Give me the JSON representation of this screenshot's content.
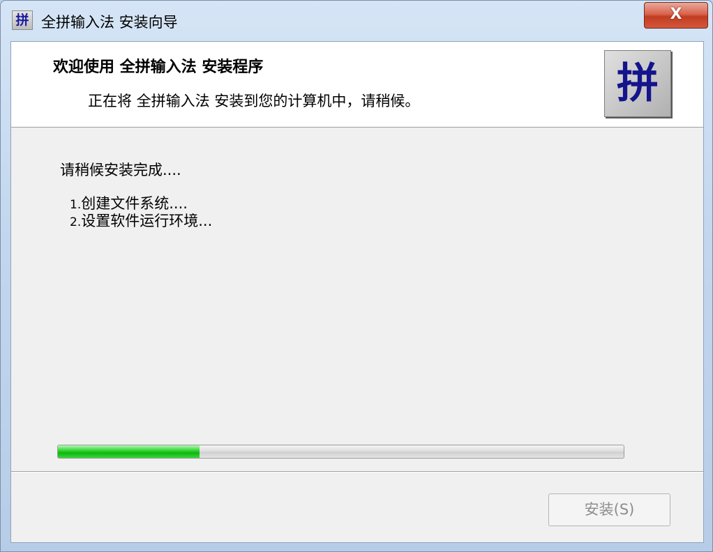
{
  "window": {
    "title": "全拼输入法 安装向导",
    "app_icon_glyph": "拼",
    "close_glyph": "X"
  },
  "header": {
    "title": "欢迎使用  全拼输入法  安装程序",
    "subtitle": "正在将 全拼输入法 安装到您的计算机中，请稍候。",
    "logo_glyph": "拼"
  },
  "content": {
    "status": "请稍候安装完成....",
    "steps": [
      {
        "num": "1.",
        "label": "创建文件系统...."
      },
      {
        "num": "2.",
        "label": "设置软件运行环境..."
      }
    ]
  },
  "progress": {
    "fraction": 0.25
  },
  "buttons": {
    "install_label": "安装(S)"
  },
  "colors": {
    "progress_fill": "#0db80d",
    "close_button": "#c23d22",
    "logo_text": "#14148c"
  },
  "icons": {
    "app": "pinyin-app-icon",
    "close": "close-icon",
    "logo": "pinyin-logo-icon"
  }
}
